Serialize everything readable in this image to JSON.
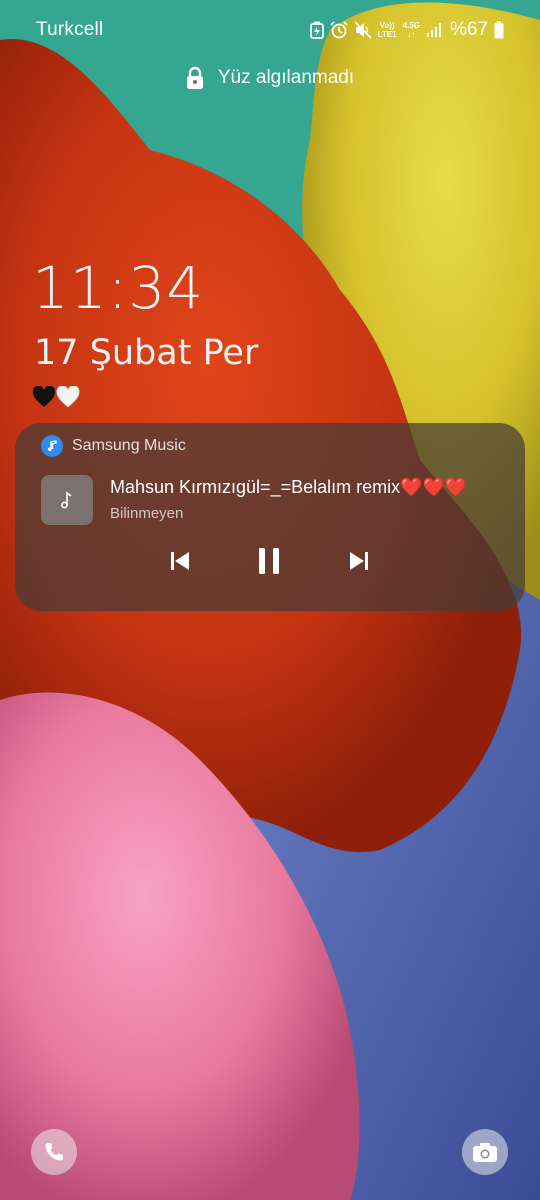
{
  "status_bar": {
    "carrier": "Turkcell",
    "volte_top": "Vo))",
    "volte_bottom": "LTE1",
    "network": "4.5G",
    "battery": "%67",
    "icons": [
      "battery-saver-icon",
      "alarm-icon",
      "mute-icon",
      "volte-icon",
      "4g-icon",
      "signal-icon",
      "battery-icon"
    ]
  },
  "lock": {
    "message": "Yüz algılanmadı",
    "icon": "lock-icon"
  },
  "clock": {
    "time": "11:34",
    "date": "17 Şubat Per"
  },
  "owner_info": {
    "emojis": [
      "black-heart",
      "white-heart"
    ]
  },
  "media_card": {
    "app_name": "Samsung Music",
    "title": "Mahsun Kırmızıgül=_=Belalım remix❤️❤️❤️",
    "artist": "Bilinmeyen",
    "controls": [
      "previous-icon",
      "pause-icon",
      "next-icon"
    ]
  },
  "shortcuts": {
    "left": "phone-icon",
    "right": "camera-icon"
  }
}
